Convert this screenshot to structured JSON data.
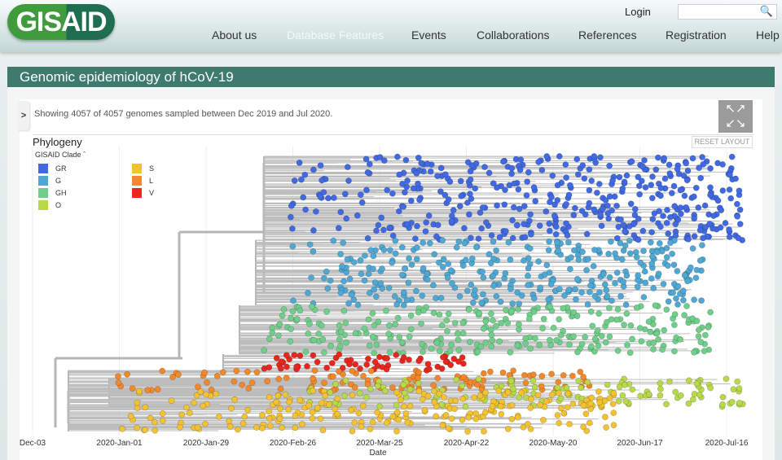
{
  "header": {
    "logo": "GISAID",
    "login": "Login",
    "search_placeholder": "",
    "nav": [
      {
        "label": "About us"
      },
      {
        "label": "Database Features",
        "active": true
      },
      {
        "label": "Events"
      },
      {
        "label": "Collaborations"
      },
      {
        "label": "References"
      },
      {
        "label": "Registration"
      },
      {
        "label": "Help"
      }
    ]
  },
  "page_title": "Genomic epidemiology of hCoV-19",
  "toolbar": {
    "showing": "Showing 4057 of 4057 genomes sampled between Dec 2019 and Jul 2020.",
    "reset_label": "RESET LAYOUT",
    "expand_icon": "expand-arrows-icon",
    "toggle_icon": "chevron-right-icon"
  },
  "chart_data": {
    "type": "scatter",
    "subtype": "phylogenetic-tree",
    "title": "Phylogeny",
    "legend_title": "GISAID Clade",
    "legend_placement": "top-left",
    "xlabel": "Date",
    "xticks": [
      "Dec-03",
      "2020-Jan-01",
      "2020-Jan-29",
      "2020-Feb-26",
      "2020-Mar-25",
      "2020-Apr-22",
      "2020-May-20",
      "2020-Jun-17",
      "2020-Jul-16"
    ],
    "xlim": [
      "2019-Dec-03",
      "2020-Jul-25"
    ],
    "grid": true,
    "genomes_shown": 4057,
    "genomes_total": 4057,
    "clades": [
      {
        "name": "GR",
        "color": "#4169e1"
      },
      {
        "name": "G",
        "color": "#4fa8d3"
      },
      {
        "name": "GH",
        "color": "#6fcf8a"
      },
      {
        "name": "O",
        "color": "#b8d94a"
      },
      {
        "name": "S",
        "color": "#f2c232"
      },
      {
        "name": "L",
        "color": "#f2882a"
      },
      {
        "name": "V",
        "color": "#e8261e"
      }
    ]
  }
}
